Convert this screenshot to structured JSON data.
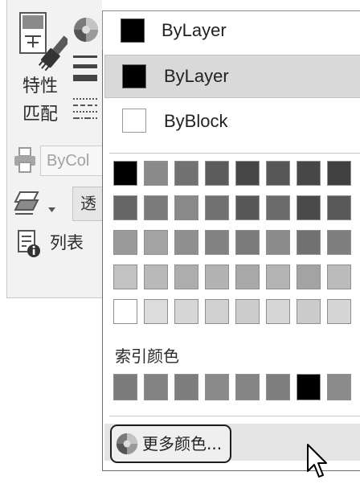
{
  "left_panel": {
    "match_properties": {
      "line1": "特性",
      "line2": "匹配"
    },
    "plot_style": {
      "value": "ByCol"
    },
    "transparency": {
      "value": "透"
    },
    "list": {
      "label": "列表"
    }
  },
  "color_combo": {
    "selected_label": "ByLayer",
    "selected_color": "#000000"
  },
  "color_dropdown": {
    "special_items": [
      {
        "label": "ByLayer",
        "swatch_color": "#000000",
        "highlighted": true
      },
      {
        "label": "ByBlock",
        "swatch_color": "#ffffff",
        "highlighted": false
      }
    ],
    "standard_colors": [
      [
        "#000000",
        "#8a8a8a",
        "#727272",
        "#5c5c5c",
        "#474747",
        "#575757",
        "#474747",
        "#404040"
      ],
      [
        "#666666",
        "#7b7b7b",
        "#898989",
        "#717171",
        "#585858",
        "#6b6b6b",
        "#4a4a4a",
        "#595959"
      ],
      [
        "#9a9a9a",
        "#a3a3a3",
        "#8f8f8f",
        "#828282",
        "#7b7b7b",
        "#8c8c8c",
        "#717171",
        "#7f7f7f"
      ],
      [
        "#c2c2c2",
        "#b9b9b9",
        "#adadad",
        "#b3b3b3",
        "#a8a8a8",
        "#b4b4b4",
        "#a3a3a3",
        "#bbbbbb"
      ],
      [
        "#ffffff",
        "#dcdcdc",
        "#d6d6d6",
        "#d1d1d1",
        "#cdcdcd",
        "#d6d6d6",
        "#cbcbcb",
        "#d5d5d5"
      ]
    ],
    "index_colors_label": "索引颜色",
    "index_colors": [
      "#7b7b7b",
      "#838383",
      "#7d7d7d",
      "#8a8a8a",
      "#858585",
      "#7f7f7f",
      "#000000",
      "#8c8c8c"
    ],
    "more_colors_label": "更多颜色..."
  },
  "icons": {
    "match_properties": "match-properties-icon",
    "color": "color-wheel-icon",
    "lineweight": "lineweight-icon",
    "linetype": "linetype-icon",
    "plot_style": "printer-icon",
    "transparency": "transparency-icon",
    "list": "list-info-icon",
    "more_colors": "color-wheel-icon",
    "pointer": "mouse-pointer-icon"
  },
  "theme": {
    "panel_background": "#f2f2f2",
    "selected_row": "#d9d9d9",
    "hover_row": "#e4e4e4",
    "border": "#6f6f6f"
  }
}
